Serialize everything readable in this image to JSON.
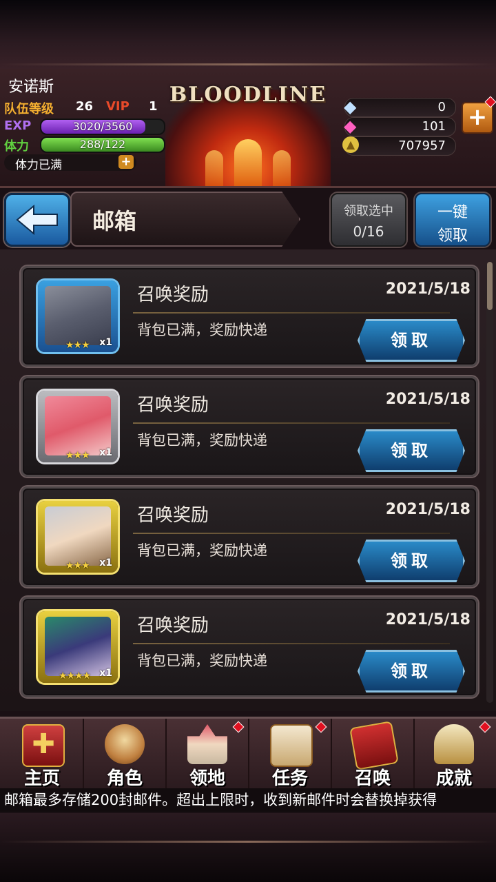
{
  "player": {
    "name": "安诺斯",
    "team_level_label": "队伍等级",
    "team_level": "26",
    "vip_label": "VIP",
    "vip_level": "1",
    "exp_label": "EXP",
    "exp_value": "3020/3560",
    "exp_progress": 0.85,
    "stamina_label": "体力",
    "stamina_value": "288/122",
    "stamina_progress": 1.0,
    "stamina_status": "体力已满"
  },
  "logo": "BLOODLINE",
  "resources": {
    "crystal": "0",
    "gem": "101",
    "gold": "707957"
  },
  "page": {
    "title": "邮箱",
    "claim_selected_label": "领取选中",
    "claim_selected_count": "0/16",
    "claim_all_line1": "一键",
    "claim_all_line2": "领取"
  },
  "mails": [
    {
      "title": "召唤奖励",
      "date": "2021/5/18",
      "desc": "背包已满，奖励快递",
      "button": "领取",
      "stars": "★★★",
      "qty": "x1",
      "frame": "blue"
    },
    {
      "title": "召唤奖励",
      "date": "2021/5/18",
      "desc": "背包已满，奖励快递",
      "button": "领取",
      "stars": "★★★",
      "qty": "x1",
      "frame": "silver"
    },
    {
      "title": "召唤奖励",
      "date": "2021/5/18",
      "desc": "背包已满，奖励快递",
      "button": "领取",
      "stars": "★★★",
      "qty": "x1",
      "frame": "gold"
    },
    {
      "title": "召唤奖励",
      "date": "2021/5/18",
      "desc": "背包已满，奖励快递",
      "button": "领取",
      "stars": "★★★★",
      "qty": "x1",
      "frame": "gold"
    }
  ],
  "nav": [
    {
      "label": "主页",
      "icon": "home-banner-icon"
    },
    {
      "label": "角色",
      "icon": "character-icon"
    },
    {
      "label": "领地",
      "icon": "castle-icon"
    },
    {
      "label": "任务",
      "icon": "quest-book-icon"
    },
    {
      "label": "召唤",
      "icon": "summon-card-icon"
    },
    {
      "label": "成就",
      "icon": "trophy-icon"
    }
  ],
  "notice": "邮箱最多存储200封邮件。超出上限时，收到新邮件时会替换掉获得",
  "colors": {
    "blue_button": "#1a5aa0",
    "exp_bar": "#8a3ad0",
    "stamina_bar": "#5ab030",
    "badge": "#e01020"
  }
}
